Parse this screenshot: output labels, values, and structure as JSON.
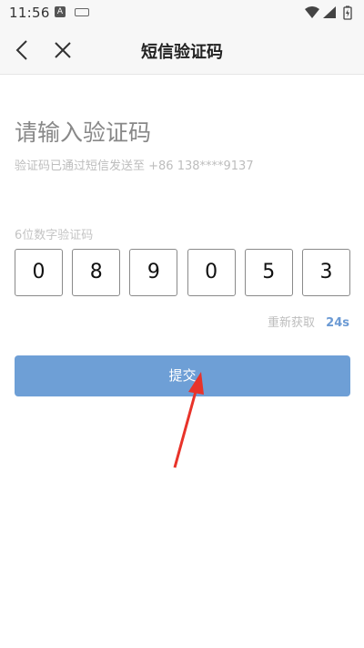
{
  "status": {
    "time": "11:56",
    "a_badge": "A"
  },
  "nav": {
    "title": "短信验证码"
  },
  "main": {
    "heading": "请输入验证码",
    "subtext": "验证码已通过短信发送至 +86 138****9137",
    "code_label": "6位数字验证码",
    "digits": [
      "0",
      "8",
      "9",
      "0",
      "5",
      "3"
    ],
    "resend_label": "重新获取",
    "resend_countdown": "24s",
    "submit_label": "提交"
  },
  "colors": {
    "accent": "#6e9fd6",
    "countdown": "#6b9ad4",
    "arrow": "#e8332a"
  },
  "icons": {
    "back": "chevron-left-icon",
    "close": "close-icon",
    "wifi": "wifi-icon",
    "signal": "signal-icon",
    "battery": "battery-icon"
  }
}
